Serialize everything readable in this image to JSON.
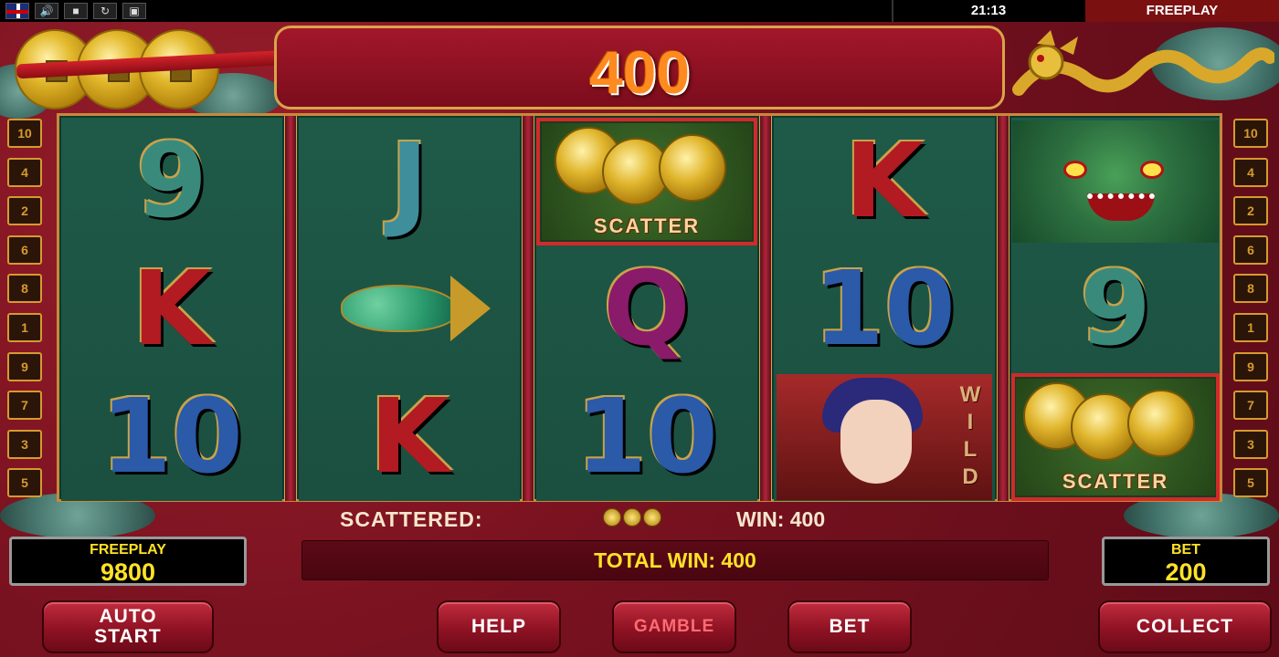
{
  "topbar": {
    "icons": [
      "uk-flag-icon",
      "speaker-icon",
      "fullscreen-icon",
      "refresh-icon",
      "window-icon"
    ],
    "clock": "21:13",
    "mode_tab": "FREEPLAY"
  },
  "header": {
    "win_amount": "400"
  },
  "side_markers": {
    "left": [
      "10",
      "4",
      "2",
      "6",
      "8",
      "1",
      "9",
      "7",
      "3",
      "5"
    ],
    "right": [
      "10",
      "4",
      "2",
      "6",
      "8",
      "1",
      "9",
      "7",
      "3",
      "5"
    ]
  },
  "reels": [
    [
      {
        "symbol": "9",
        "color": "teal"
      },
      {
        "symbol": "K",
        "color": "red"
      },
      {
        "symbol": "10",
        "color": "blue"
      }
    ],
    [
      {
        "symbol": "J",
        "color": "cyan"
      },
      {
        "symbol": "fish-icon",
        "color": "green"
      },
      {
        "symbol": "K",
        "color": "red"
      }
    ],
    [
      {
        "symbol": "SCATTER",
        "color": "gold",
        "highlight": true
      },
      {
        "symbol": "Q",
        "color": "purple"
      },
      {
        "symbol": "10",
        "color": "blue"
      }
    ],
    [
      {
        "symbol": "K",
        "color": "red"
      },
      {
        "symbol": "10",
        "color": "blue"
      },
      {
        "symbol": "WILD",
        "color": "red"
      }
    ],
    [
      {
        "symbol": "dragon-icon",
        "color": "green"
      },
      {
        "symbol": "9",
        "color": "teal"
      },
      {
        "symbol": "SCATTER",
        "color": "gold",
        "highlight": true
      }
    ]
  ],
  "info": {
    "scattered_label": "SCATTERED:",
    "win_text": "WIN: 400",
    "total_win_text": "TOTAL WIN: 400"
  },
  "freeplay_display": {
    "title": "FREEPLAY",
    "value": "9800"
  },
  "bet_display": {
    "title": "BET",
    "value": "200"
  },
  "buttons": {
    "auto_start_line1": "AUTO",
    "auto_start_line2": "START",
    "help": "HELP",
    "gamble": "GAMBLE",
    "bet": "BET",
    "collect": "COLLECT"
  },
  "colors": {
    "win_orange": "#ff8a1f",
    "display_yellow": "#ffe227",
    "felt_red": "#8e1223",
    "reel_green": "#1f5a48"
  }
}
